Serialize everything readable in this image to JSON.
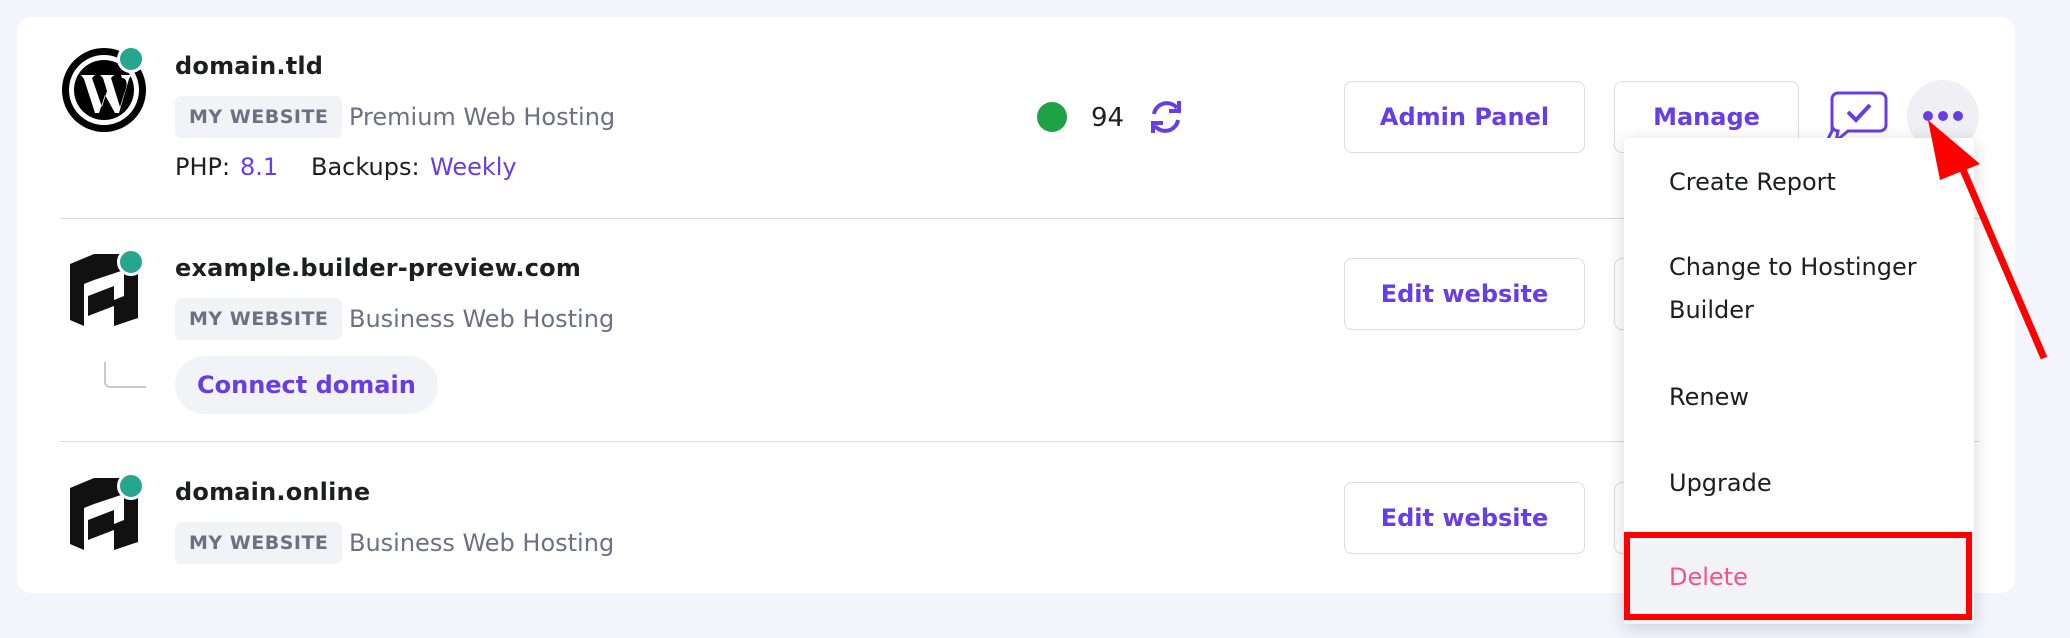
{
  "websites": [
    {
      "domain": "domain.tld",
      "badge": "MY WEBSITE",
      "plan": "Premium Web Hosting",
      "php_label": "PHP:",
      "php_value": "8.1",
      "backups_label": "Backups:",
      "backups_value": "Weekly",
      "score": "94",
      "admin_panel_label": "Admin Panel",
      "manage_label": "Manage"
    },
    {
      "domain": "example.builder-preview.com",
      "badge": "MY WEBSITE",
      "plan": "Business Web Hosting",
      "edit_label": "Edit website",
      "connect_domain_label": "Connect domain"
    },
    {
      "domain": "domain.online",
      "badge": "MY WEBSITE",
      "plan": "Business Web Hosting",
      "edit_label": "Edit website"
    }
  ],
  "dropdown": {
    "items": [
      "Create Report",
      "Change to Hostinger",
      "Builder",
      "Renew",
      "Upgrade",
      "Delete"
    ]
  },
  "icons": {
    "wordpress": "wordpress-logo",
    "builder": "hostinger-builder-logo",
    "refresh": "refresh-icon",
    "chat": "chat-check-icon",
    "more": "more-dots-icon"
  },
  "colors": {
    "accent": "#673de6",
    "online": "#26a68e",
    "status_good": "#1fa246",
    "delete": "#fc5185",
    "highlight": "#ff0000"
  }
}
